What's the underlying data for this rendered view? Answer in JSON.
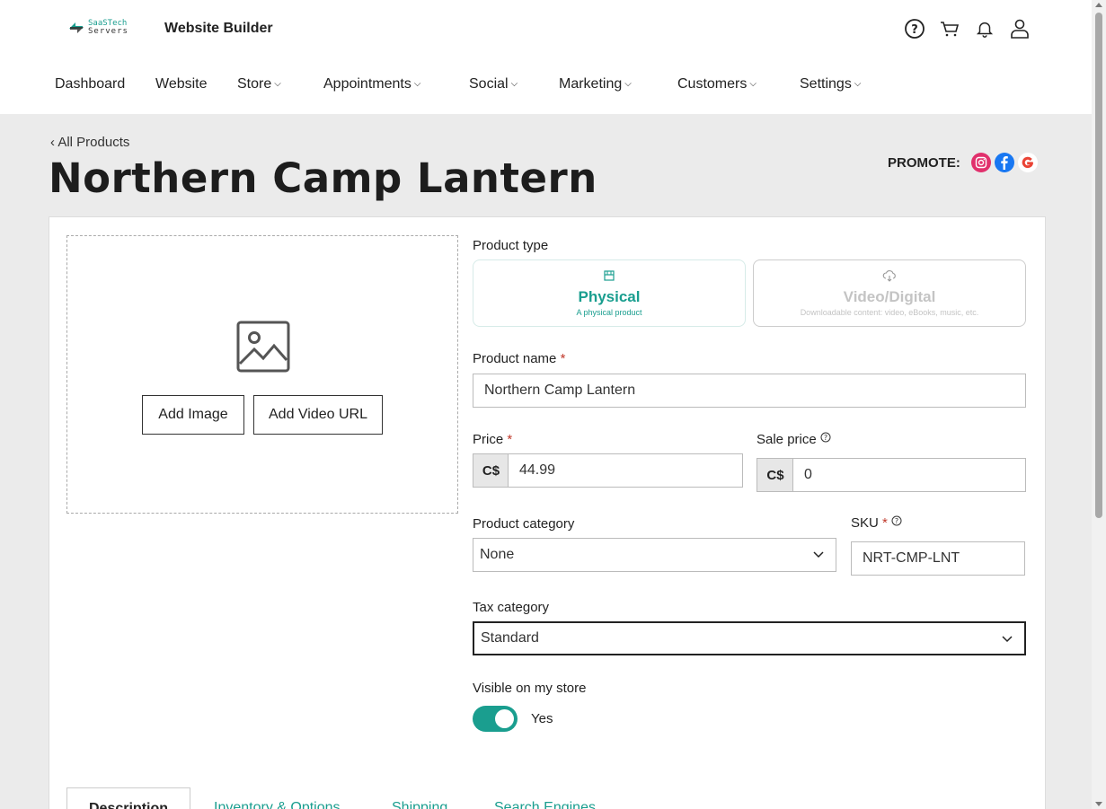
{
  "header": {
    "logo_line1": "SaaSTech",
    "logo_line2": "Servers",
    "app_title": "Website Builder",
    "icons": [
      "help-icon",
      "cart-icon",
      "bell-icon",
      "user-icon"
    ]
  },
  "nav": {
    "items": [
      {
        "label": "Dashboard",
        "chevron": ""
      },
      {
        "label": "Website",
        "chevron": ""
      },
      {
        "label": "Store",
        "chevron": "⌵"
      },
      {
        "label": "Appointments",
        "chevron": "⌵"
      },
      {
        "label": "Social",
        "chevron": "⌵"
      },
      {
        "label": "Marketing",
        "chevron": "⌵"
      },
      {
        "label": "Customers",
        "chevron": "⌵"
      },
      {
        "label": "Settings",
        "chevron": "⌵"
      }
    ]
  },
  "breadcrumb": "‹ All Products",
  "page_title": "Northern Camp Lantern",
  "promote": {
    "label": "PROMOTE:",
    "icons": [
      "instagram-icon",
      "facebook-icon",
      "google-icon"
    ]
  },
  "media": {
    "add_image_label": "Add Image",
    "add_video_label": "Add Video URL"
  },
  "product_type": {
    "label": "Product type",
    "options": [
      {
        "title": "Physical",
        "desc": "A physical product",
        "selected": true
      },
      {
        "title": "Video/Digital",
        "desc": "Downloadable content: video, eBooks, music, etc.",
        "selected": false
      }
    ]
  },
  "product_name": {
    "label": "Product name",
    "required_mark": "*",
    "value": "Northern Camp Lantern"
  },
  "price": {
    "label": "Price",
    "required_mark": "*",
    "currency": "C$",
    "value": "44.99"
  },
  "sale_price": {
    "label": "Sale price",
    "currency": "C$",
    "value": "0"
  },
  "category": {
    "label": "Product category",
    "value": "None"
  },
  "sku": {
    "label": "SKU",
    "required_mark": "*",
    "value": "NRT-CMP-LNT"
  },
  "tax_category": {
    "label": "Tax category",
    "value": "Standard"
  },
  "visible": {
    "label": "Visible on my store",
    "value_label": "Yes",
    "on": true
  },
  "tabs": [
    "Description",
    "Inventory & Options",
    "Shipping",
    "Search Engines"
  ],
  "colors": {
    "accent": "#1a9e8f",
    "required": "#c0392b"
  }
}
